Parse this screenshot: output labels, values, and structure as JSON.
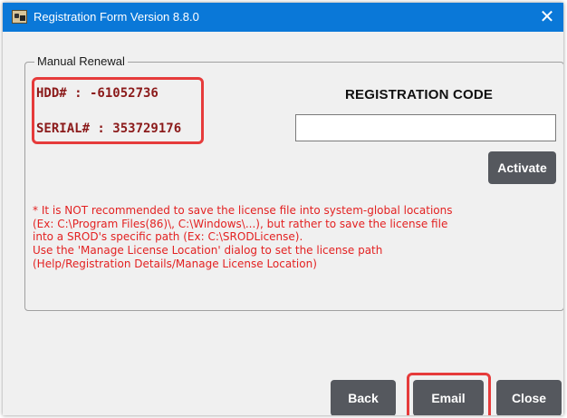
{
  "window": {
    "title": "Registration Form Version 8.8.0",
    "close_glyph": "✕",
    "title_color": "#0a78d8"
  },
  "group": {
    "legend": "Manual Renewal"
  },
  "hardware": {
    "hdd": "HDD# : -61052736",
    "serial": "SERIAL# : 353729176"
  },
  "registration": {
    "heading": "REGISTRATION CODE",
    "input_value": "",
    "activate_label": "Activate"
  },
  "notice": {
    "lines": [
      "* It is NOT recommended to save the license file into system-global locations",
      "(Ex: C:\\Program Files(86)\\, C:\\Windows\\...), but rather to save the license file",
      "into a SROD's specific path (Ex: C:\\SRODLicense).",
      "Use the 'Manage License Location' dialog to set the license path",
      "(Help/Registration Details/Manage License Location)"
    ],
    "color": "#e32222"
  },
  "footer": {
    "back_label": "Back",
    "email_label": "Email",
    "close_label": "Close"
  },
  "highlight_color": "#e63b3b",
  "icons": {
    "app": "registration-app-icon",
    "close": "close-icon"
  }
}
